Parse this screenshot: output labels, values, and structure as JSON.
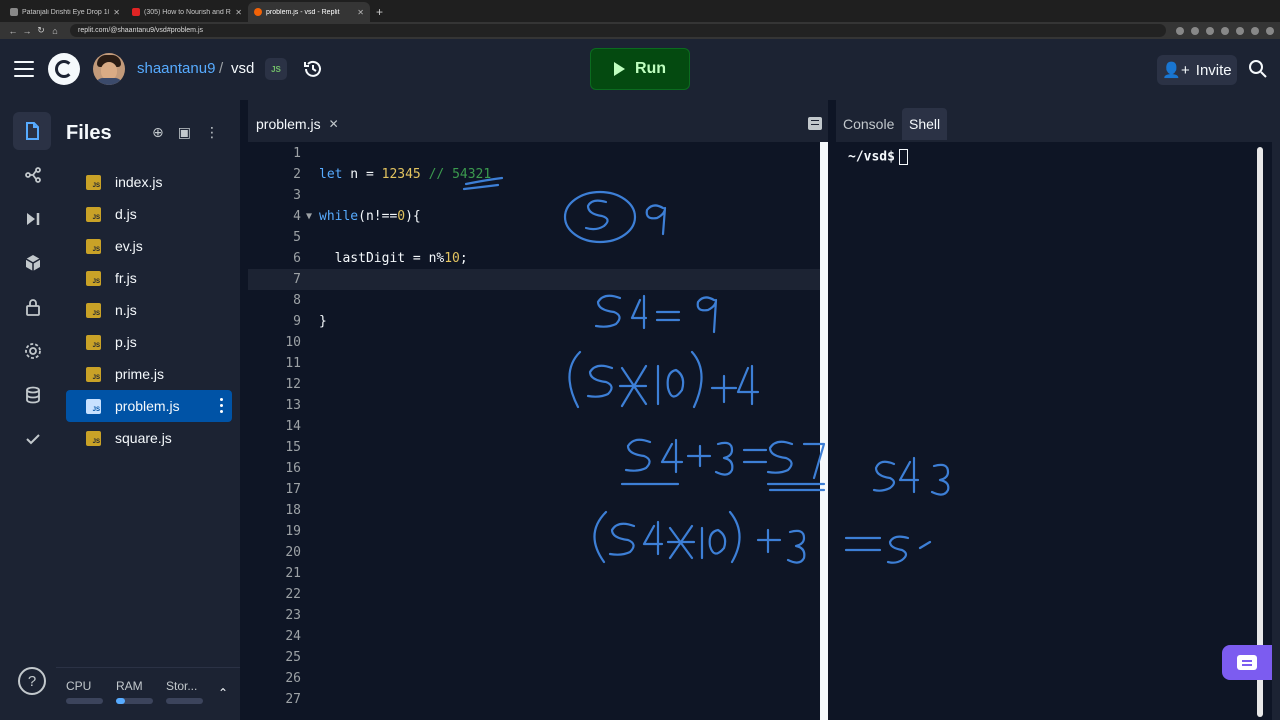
{
  "browser": {
    "tabs": [
      {
        "title": "Patanjali Drishti Eye Drop 10 m",
        "active": false
      },
      {
        "title": "(305) How to Nourish and Reli",
        "active": false
      },
      {
        "title": "problem.js - vsd - Replit",
        "active": true
      }
    ],
    "url": "replit.com/@shaantanu9/vsd#problem.js"
  },
  "header": {
    "username": "shaantanu9",
    "separator": "/",
    "repl_name": "vsd",
    "run_label": "Run",
    "invite_label": "Invite"
  },
  "files_panel": {
    "title": "Files",
    "files": [
      "index.js",
      "d.js",
      "ev.js",
      "fr.js",
      "n.js",
      "p.js",
      "prime.js",
      "problem.js",
      "square.js"
    ],
    "active_file": "problem.js",
    "file_icon_text": "JS",
    "resources": [
      "CPU",
      "RAM",
      "Stor..."
    ],
    "resource_usage": [
      0,
      0.25,
      0
    ]
  },
  "editor": {
    "tab_label": "problem.js",
    "current_line": 7,
    "line_count": 27,
    "lines": [
      [],
      [
        {
          "t": "kw",
          "v": "let"
        },
        {
          "t": "p",
          "v": " n = "
        },
        {
          "t": "num",
          "v": "12345"
        },
        {
          "t": "p",
          "v": " "
        },
        {
          "t": "cm",
          "v": "// 54321"
        }
      ],
      [],
      [
        {
          "t": "kw",
          "v": "while"
        },
        {
          "t": "p",
          "v": "(n!=="
        },
        {
          "t": "num",
          "v": "0"
        },
        {
          "t": "p",
          "v": "){"
        }
      ],
      [],
      [
        {
          "t": "p",
          "v": "  lastDigit = n%"
        },
        {
          "t": "num",
          "v": "10"
        },
        {
          "t": "p",
          "v": ";"
        }
      ],
      [],
      [],
      [
        {
          "t": "p",
          "v": "}"
        }
      ]
    ],
    "fold_line": 4
  },
  "right_panel": {
    "tabs": [
      "Console",
      "Shell"
    ],
    "active_tab": "Shell",
    "prompt": "~/vsd$"
  },
  "colors": {
    "accent_blue": "#57abff",
    "run_green": "#044a10",
    "ink": "#3d7fd6"
  }
}
